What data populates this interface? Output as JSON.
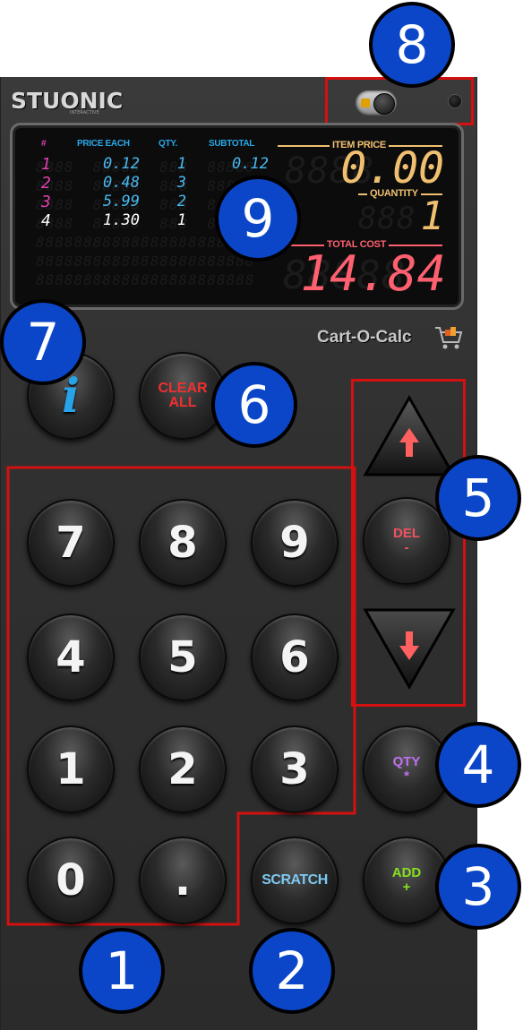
{
  "brand": {
    "logo": "STUONIC",
    "logo_sub": "INTERACTIVE",
    "app_name": "Cart-O-Calc"
  },
  "display": {
    "headers": {
      "index": "#",
      "price_each": "PRICE EACH",
      "qty": "QTY.",
      "subtotal": "SUBTOTAL"
    },
    "items": [
      {
        "index": "1",
        "price_each": "0.12",
        "qty": "1",
        "subtotal": "0.12",
        "color": "#e040b0"
      },
      {
        "index": "2",
        "price_each": "0.48",
        "qty": "3",
        "subtotal": "",
        "color": "#e040b0"
      },
      {
        "index": "3",
        "price_each": "5.99",
        "qty": "2",
        "subtotal": "",
        "color": "#e040b0"
      },
      {
        "index": "4",
        "price_each": "1.30",
        "qty": "1",
        "subtotal": "",
        "color": "#ffffff"
      }
    ],
    "item_price_label": "ITEM PRICE",
    "item_price_value": "0.00",
    "quantity_label": "QUANTITY",
    "quantity_value": "1",
    "total_cost_label": "TOTAL COST",
    "total_cost_value": "14.84"
  },
  "keypad": {
    "digits": [
      "7",
      "8",
      "9",
      "4",
      "5",
      "6",
      "1",
      "2",
      "3",
      "0",
      "."
    ],
    "clear_all": "CLEAR\nALL",
    "info": "i",
    "scratch": "SCRATCH",
    "add": "ADD\n+",
    "qty": "QTY\n*",
    "del": "DEL\n-"
  },
  "callouts": [
    "1",
    "2",
    "3",
    "4",
    "5",
    "6",
    "7",
    "8",
    "9"
  ],
  "colors": {
    "lcd_label_blue": "#28a8e8",
    "item_price_orange": "#f0c070",
    "total_cost_red": "#ff6070",
    "annotation_red": "#d41010",
    "callout_blue": "#0b46c8",
    "info_blue": "#29a3e8",
    "clear_red": "#f03030",
    "scratch_blue": "#7cc8f0",
    "add_green": "#86e020",
    "qty_purple": "#c070f0",
    "del_red": "#f05060"
  },
  "icons": [
    "up-arrow-icon",
    "down-arrow-icon",
    "shopping-cart-icon",
    "info-icon",
    "toggle-switch",
    "led-indicator"
  ]
}
